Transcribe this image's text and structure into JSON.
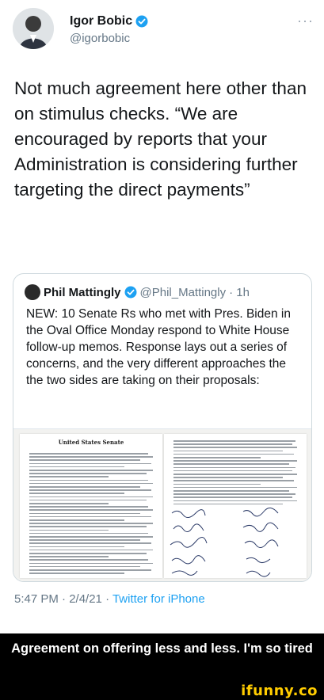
{
  "tweet": {
    "author_name": "Igor Bobic",
    "author_handle": "@igorbobic",
    "text": "Not much agreement here other than on stimulus checks. “We are encouraged by reports that your Administration is considering further targeting the direct payments”",
    "more_label": "···",
    "timestamp": "5:47 PM · 2/4/21 · ",
    "source": "Twitter for iPhone"
  },
  "quoted_tweet": {
    "author_name": "Phil Mattingly",
    "author_handle": "@Phil_Mattingly",
    "time_ago": "· 1h",
    "text": "NEW: 10 Senate Rs who met with Pres. Biden in the Oval Office Monday respond to White House follow-up memos. Response lays out a series of concerns, and the very different approaches the the two sides are taking on their proposals:",
    "document_letterhead": "United States Senate"
  },
  "caption": {
    "text": "Agreement on offering less and less. I'm so tired"
  },
  "watermark": {
    "text": "ifunny.co"
  },
  "colors": {
    "verified_blue": "#1da1f2",
    "link_blue": "#1da1f2",
    "secondary_text": "#657786",
    "watermark_yellow": "#ffcc00"
  },
  "icons": {
    "verified": "verified-badge-icon",
    "more": "more-options-icon"
  }
}
